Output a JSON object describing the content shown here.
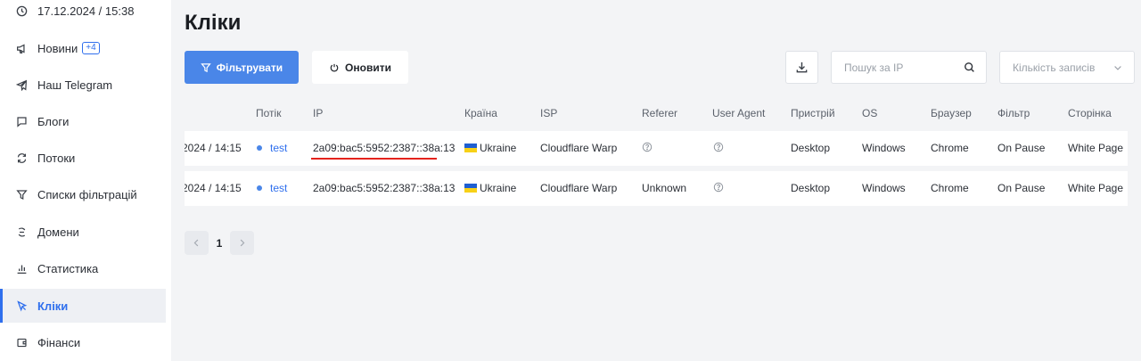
{
  "sidebar": {
    "items": [
      {
        "label": "17.12.2024 / 15:38",
        "icon": "clock-icon"
      },
      {
        "label": "Новини",
        "icon": "megaphone-icon",
        "badge": "+4"
      },
      {
        "label": "Наш Telegram",
        "icon": "telegram-icon"
      },
      {
        "label": "Блоги",
        "icon": "chat-icon"
      },
      {
        "label": "Потоки",
        "icon": "refresh-arrows-icon"
      },
      {
        "label": "Списки фільтрацій",
        "icon": "filter-icon"
      },
      {
        "label": "Домени",
        "icon": "link-icon"
      },
      {
        "label": "Статистика",
        "icon": "bar-chart-icon"
      },
      {
        "label": "Кліки",
        "icon": "cursor-icon",
        "active": true
      },
      {
        "label": "Фінанси",
        "icon": "wallet-icon"
      }
    ]
  },
  "main": {
    "title": "Кліки",
    "filter_label": "Фільтрувати",
    "refresh_label": "Оновити",
    "search_placeholder": "Пошук за IP",
    "records_placeholder": "Кількість записів"
  },
  "table": {
    "columns": [
      "Потік",
      "IP",
      "Країна",
      "ISP",
      "Referer",
      "User Agent",
      "Пристрій",
      "OS",
      "Браузер",
      "Фільтр",
      "Сторінка"
    ],
    "rows": [
      {
        "date": "2024 / 14:15",
        "stream": "test",
        "ip": "2a09:bac5:5952:2387::38a:13",
        "country": "Ukraine",
        "isp": "Cloudflare Warp",
        "referer": "",
        "user_agent": "",
        "device": "Desktop",
        "os": "Windows",
        "browser": "Chrome",
        "filter": "On Pause",
        "page": "White Page"
      },
      {
        "date": "2024 / 14:15",
        "stream": "test",
        "ip": "2a09:bac5:5952:2387::38a:13",
        "country": "Ukraine",
        "isp": "Cloudflare Warp",
        "referer": "Unknown",
        "user_agent": "",
        "device": "Desktop",
        "os": "Windows",
        "browser": "Chrome",
        "filter": "On Pause",
        "page": "White Page"
      }
    ]
  },
  "pagination": {
    "current": "1"
  },
  "colors": {
    "accent": "#4a86e8",
    "active_text": "#2f6fed",
    "highlight_underline": "#e4231d",
    "background": "#f3f4f6"
  }
}
